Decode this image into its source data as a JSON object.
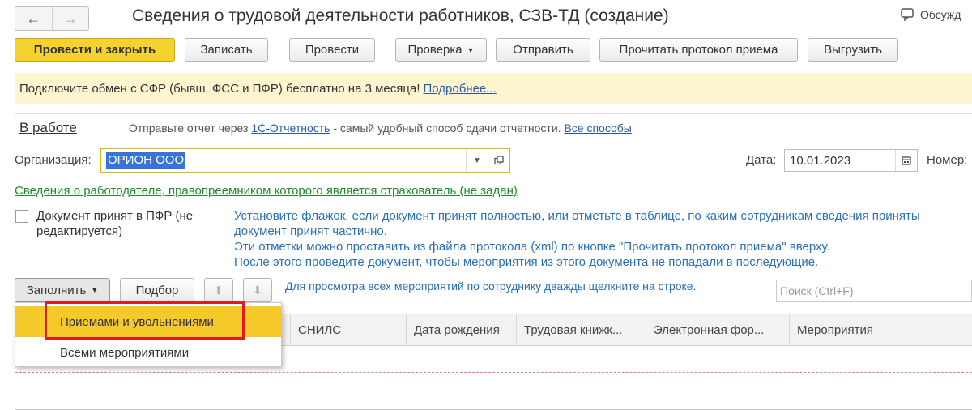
{
  "window": {
    "title": "Сведения о трудовой деятельности работников, СЗВ-ТД (создание)",
    "discuss_label": "Обсужд"
  },
  "toolbar": {
    "post_close": "Провести и закрыть",
    "save": "Записать",
    "post": "Провести",
    "check": "Проверка",
    "send": "Отправить",
    "read_protocol": "Прочитать протокол приема",
    "export": "Выгрузить"
  },
  "banner": {
    "text": "Подключите обмен с СФР (бывш. ФСС и ПФР) бесплатно на 3 месяца!",
    "link": "Подробнее..."
  },
  "status": {
    "label": "В работе",
    "prefix": "Отправьте отчет через",
    "service_link": "1С-Отчетность",
    "middle": "- самый удобный способ сдачи отчетности.",
    "all_ways_link": "Все способы"
  },
  "form": {
    "org_label": "Организация:",
    "org_value": "ОРИОН ООО",
    "date_label": "Дата:",
    "date_value": "10.01.2023",
    "number_label": "Номер:",
    "employer_link": "Сведения о работодателе, правопреемником которого является страхователь (не задан)",
    "accepted_label": "Документ принят в ПФР (не редактируется)",
    "hint_lines": [
      "Установите флажок, если документ принят полностью, или отметьте в таблице, по каким сотрудникам сведения приняты",
      "документ принят частично.",
      "Эти отметки можно проставить из файла протокола (xml) по кнопке \"Прочитать протокол приема\" вверху.",
      "После этого проведите документ, чтобы мероприятия из этого документа не попадали в последующие."
    ]
  },
  "table_toolbar": {
    "fill": "Заполнить",
    "pick": "Подбор",
    "list_hint": "Для просмотра всех мероприятий по сотруднику дважды щелкните на строке.",
    "search_placeholder": "Поиск (Ctrl+F)"
  },
  "dropdown": {
    "items": [
      "Приемами и увольнениями",
      "Всеми мероприятиями"
    ]
  },
  "table": {
    "columns": [
      "СНИЛС",
      "Дата рождения",
      "Трудовая книжк...",
      "Электронная фор...",
      "Мероприятия"
    ]
  }
}
